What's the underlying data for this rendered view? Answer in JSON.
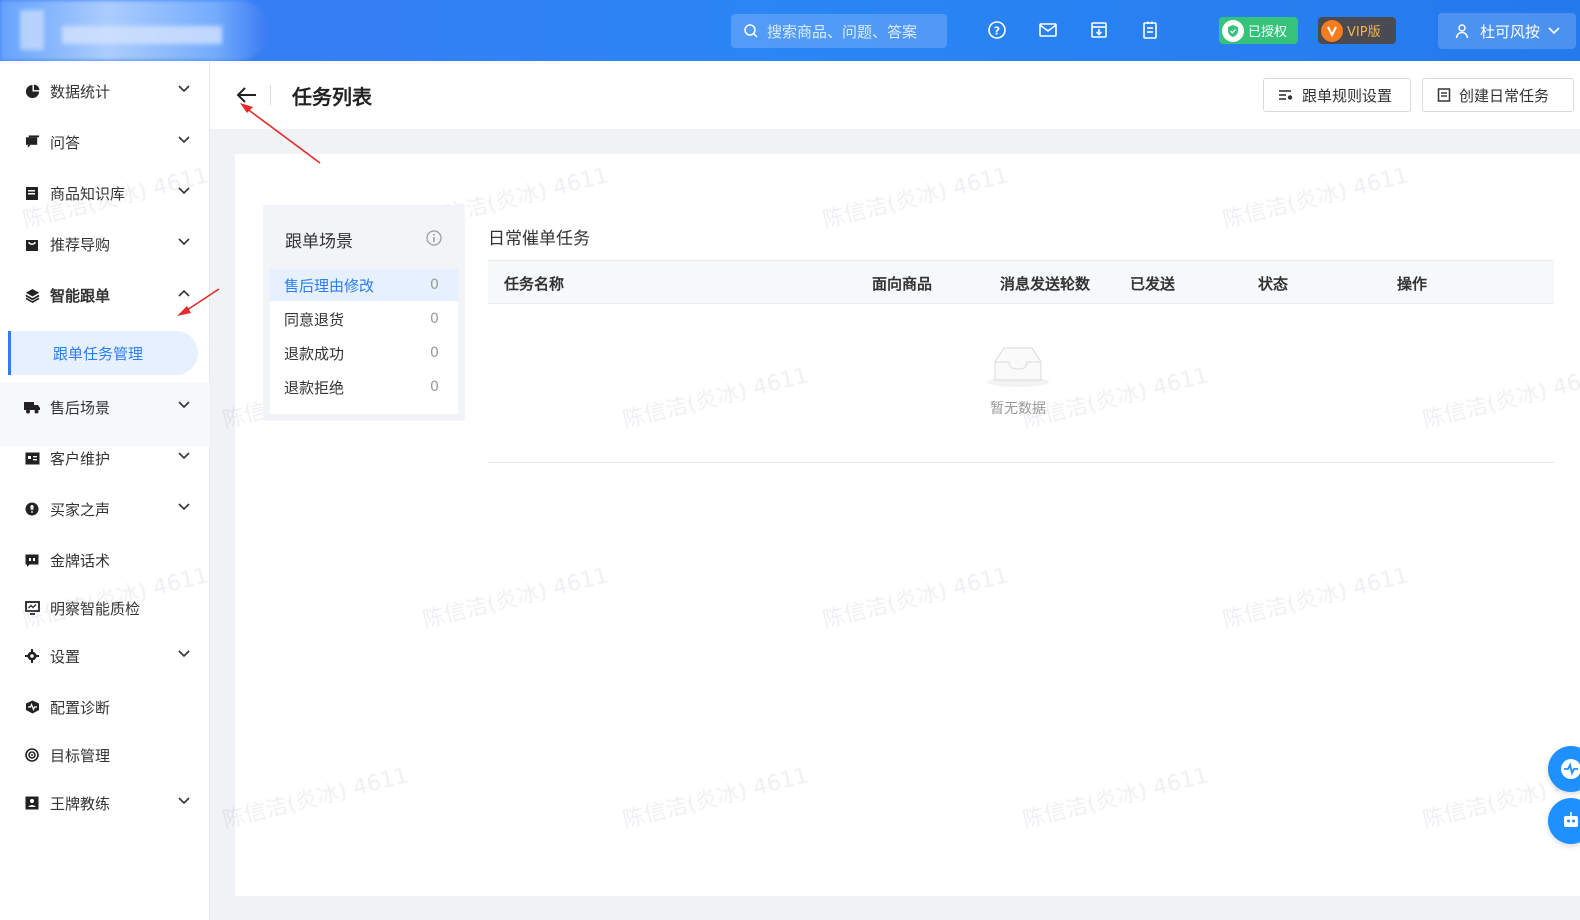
{
  "topbar": {
    "search_placeholder": "搜索商品、问题、答案",
    "auth_badge": "已授权",
    "vip_badge": "VIP版",
    "user_name": "杜可风按"
  },
  "sidebar": {
    "items": [
      {
        "label": "数据统计",
        "icon": "pie-chart-icon"
      },
      {
        "label": "问答",
        "icon": "chat-icon"
      },
      {
        "label": "商品知识库",
        "icon": "book-icon"
      },
      {
        "label": "推荐导购",
        "icon": "shopping-icon"
      },
      {
        "label": "智能跟单",
        "icon": "layers-icon"
      },
      {
        "label": "售后场景",
        "icon": "truck-icon"
      },
      {
        "label": "客户维护",
        "icon": "contact-card-icon"
      },
      {
        "label": "买家之声",
        "icon": "voice-icon"
      },
      {
        "label": "金牌话术",
        "icon": "quote-icon"
      },
      {
        "label": "明察智能质检",
        "icon": "monitor-icon"
      },
      {
        "label": "设置",
        "icon": "gear-icon"
      },
      {
        "label": "配置诊断",
        "icon": "diagnose-icon"
      },
      {
        "label": "目标管理",
        "icon": "target-icon"
      },
      {
        "label": "王牌教练",
        "icon": "coach-icon"
      }
    ],
    "sub_item": "跟单任务管理"
  },
  "header": {
    "title": "任务列表",
    "rule_button": "跟单规则设置",
    "create_button": "创建日常任务"
  },
  "scene": {
    "title": "跟单场景",
    "items": [
      {
        "label": "售后理由修改",
        "count": "0"
      },
      {
        "label": "同意退货",
        "count": "0"
      },
      {
        "label": "退款成功",
        "count": "0"
      },
      {
        "label": "退款拒绝",
        "count": "0"
      }
    ]
  },
  "tasks": {
    "title": "日常催单任务",
    "columns": [
      "任务名称",
      "面向商品",
      "消息发送轮数",
      "已发送",
      "状态",
      "操作"
    ],
    "empty_text": "暂无数据"
  },
  "watermark": "陈信洁(炎冰) 4611",
  "colors": {
    "primary": "#2b7ef5",
    "topbar": "#3c7bf2",
    "auth": "#35c27b",
    "vip_bg": "#4a4a52"
  }
}
